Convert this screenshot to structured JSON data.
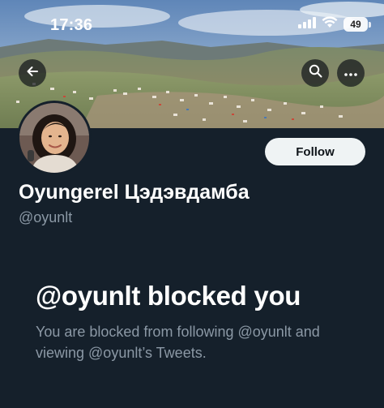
{
  "status_bar": {
    "time": "17:36",
    "battery": "49"
  },
  "banner": {
    "back_icon": "arrow-left-icon",
    "search_icon": "search-icon",
    "more_icon": "more-horizontal-icon"
  },
  "profile": {
    "display_name": "Oyungerel Цэдэвдамба",
    "handle": "@oyunlt",
    "follow_label": "Follow"
  },
  "blocked": {
    "title": "@oyunlt blocked you",
    "message": "You are blocked from following @oyunlt and viewing @oyunlt’s Tweets."
  },
  "colors": {
    "background": "#15202b",
    "secondary_text": "#8b98a5",
    "follow_button_bg": "#eff3f4"
  }
}
